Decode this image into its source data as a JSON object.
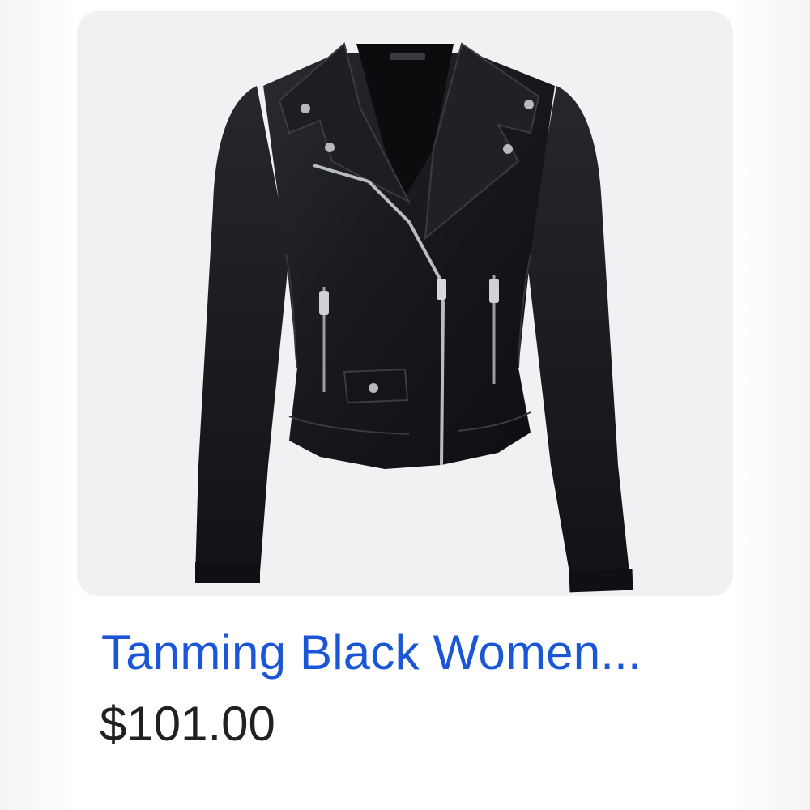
{
  "product": {
    "image_alt": "Black leather biker jacket",
    "title": "Tanming Black Women...",
    "price": "$101.00"
  },
  "colors": {
    "title": "#1a56d6",
    "price": "#202124",
    "image_background": "#f1f1f3"
  }
}
